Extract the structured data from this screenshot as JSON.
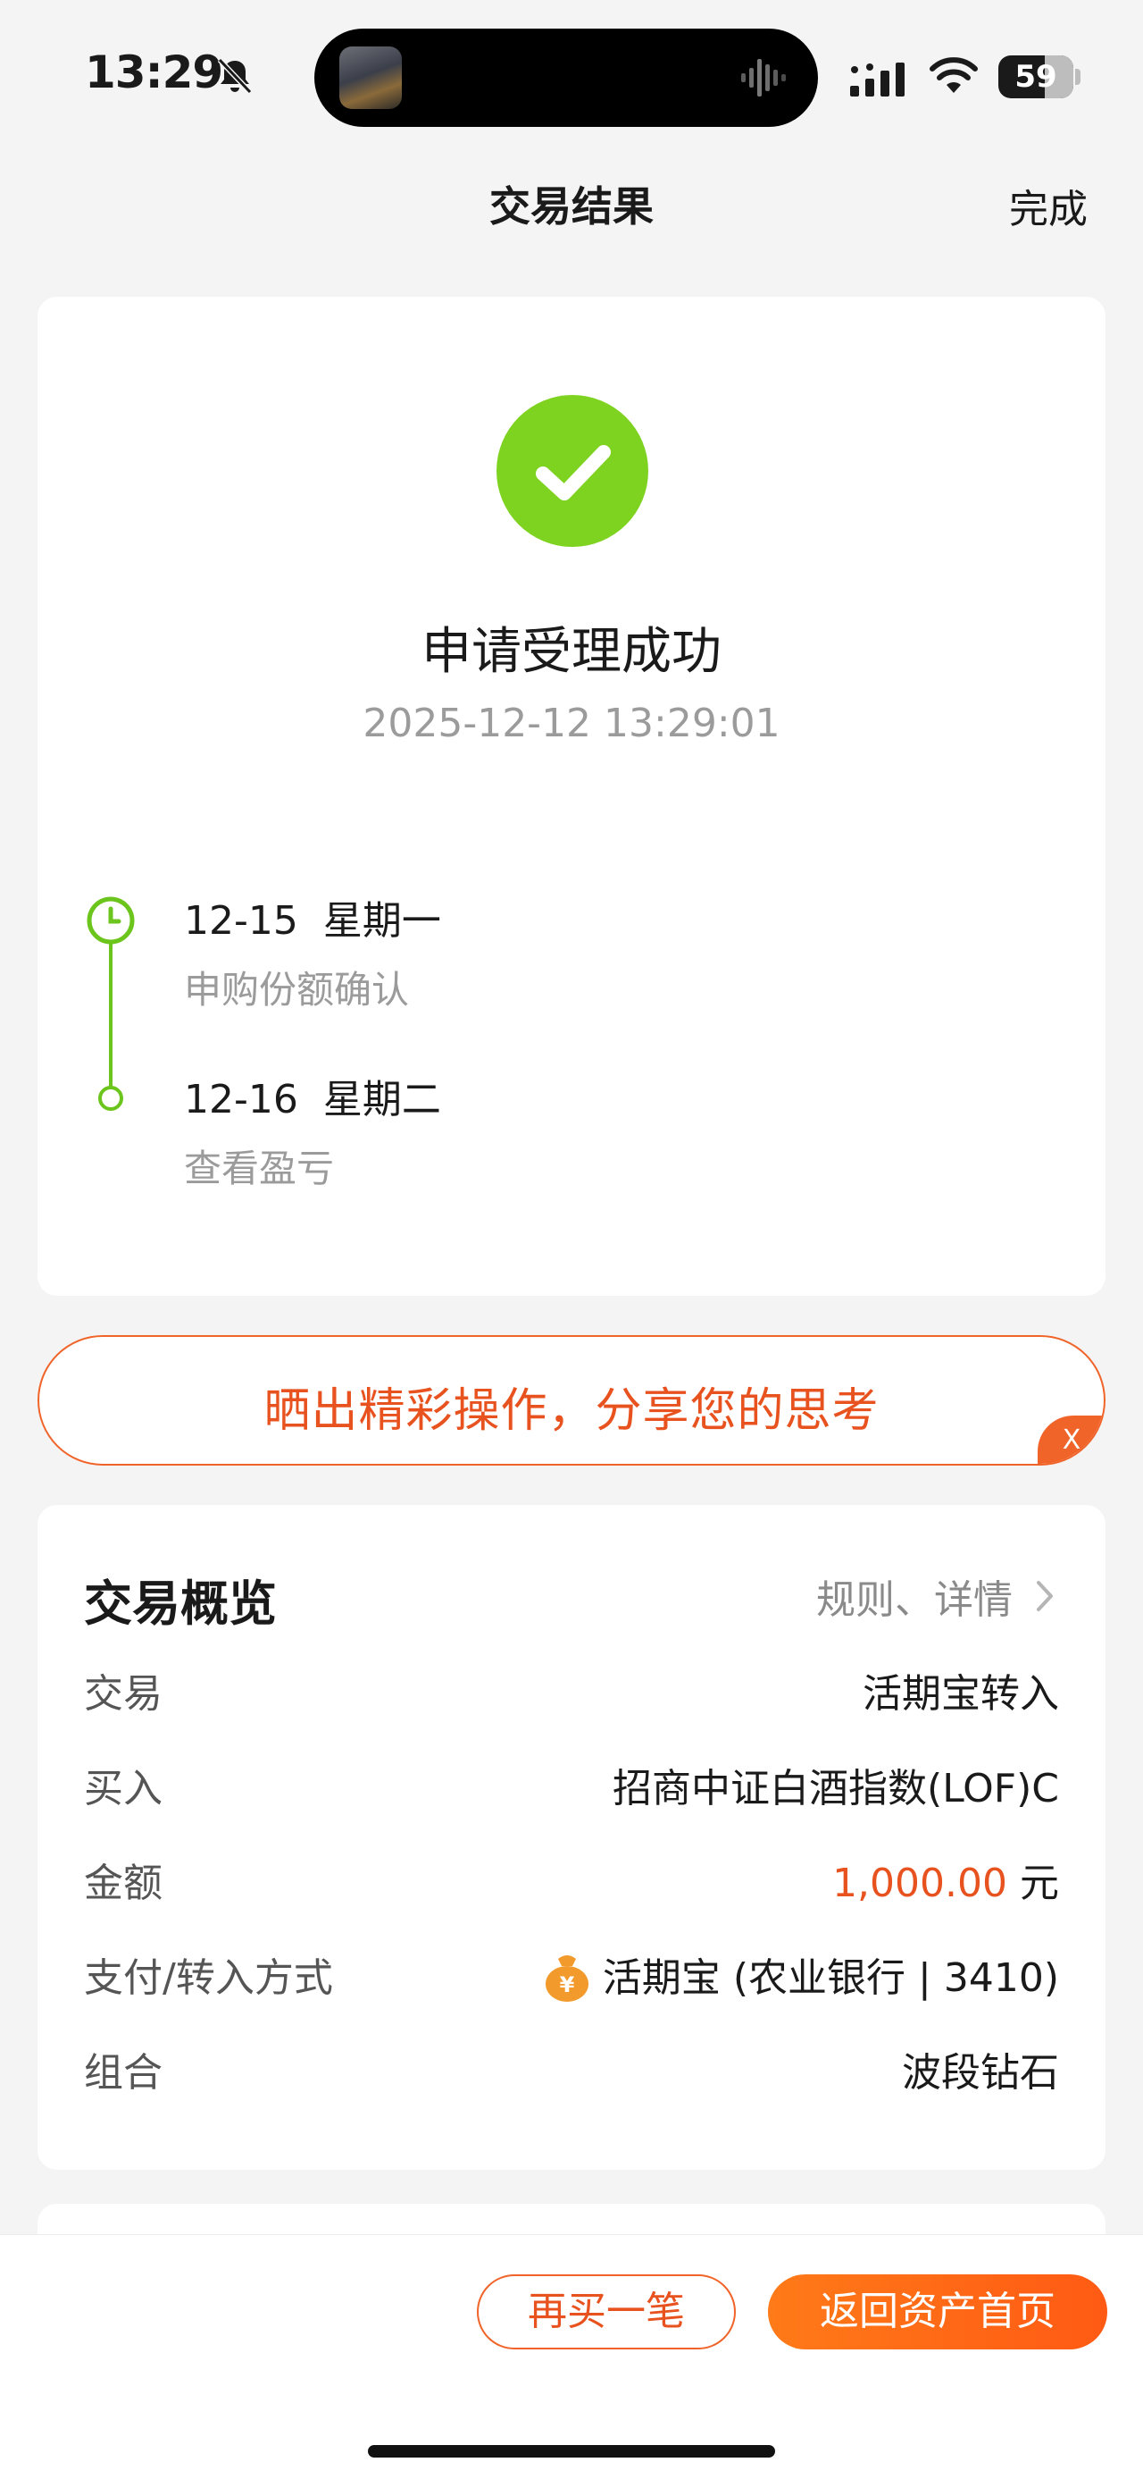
{
  "status_bar": {
    "time": "13:29",
    "battery": "59",
    "icons": [
      "bell-muted-icon",
      "signal-icon",
      "wifi-icon",
      "battery-icon"
    ]
  },
  "nav": {
    "title": "交易结果",
    "done_label": "完成"
  },
  "result": {
    "title": "申请受理成功",
    "timestamp": "2025-12-12 13:29:01",
    "timeline": [
      {
        "date": "12-15  星期一",
        "desc": "申购份额确认"
      },
      {
        "date": "12-16  星期二",
        "desc": "查看盈亏"
      }
    ]
  },
  "share_banner": {
    "text": "晒出精彩操作，分享您的思考",
    "close_label": "X"
  },
  "overview": {
    "title": "交易概览",
    "link_label": "规则、详情",
    "rows": [
      {
        "label": "交易",
        "value": "活期宝转入"
      },
      {
        "label": "买入",
        "value": "招商中证白酒指数(LOF)C"
      },
      {
        "label": "金额",
        "amount": "1,000.00",
        "unit": " 元"
      },
      {
        "label": "支付/转入方式",
        "value": "活期宝 (农业银行 | 3410)"
      },
      {
        "label": "组合",
        "value": "波段钻石"
      }
    ]
  },
  "bottom_bar": {
    "buy_again_label": "再买一笔",
    "home_label": "返回资产首页"
  },
  "colors": {
    "accent": "#f0642a",
    "success": "#7ed321",
    "timeline": "#6cc51c",
    "background": "#f4f4f4"
  }
}
